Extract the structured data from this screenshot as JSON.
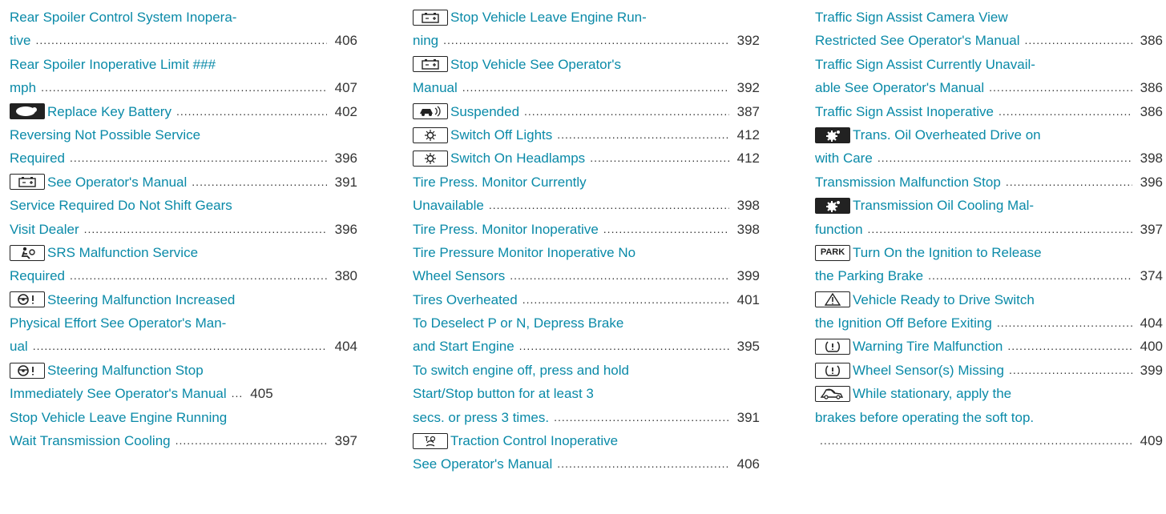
{
  "columns": [
    {
      "entries": [
        {
          "lines": [
            "Rear Spoiler Control System Inopera-",
            "tive"
          ],
          "page": "406"
        },
        {
          "lines": [
            "Rear Spoiler Inoperative Limit ###",
            "mph"
          ],
          "page": "407"
        },
        {
          "icon": "key-battery-icon",
          "lines": [
            "Replace Key Battery"
          ],
          "page": "402"
        },
        {
          "lines": [
            "Reversing Not Possible Service",
            "Required"
          ],
          "page": "396"
        },
        {
          "icon": "battery-icon",
          "lines": [
            "See Operator's Manual"
          ],
          "page": "391"
        },
        {
          "lines": [
            "Service Required Do Not Shift Gears",
            "Visit Dealer"
          ],
          "page": "396"
        },
        {
          "icon": "airbag-icon",
          "lines": [
            "SRS Malfunction Service",
            "Required"
          ],
          "page": "380"
        },
        {
          "icon": "steering-warning-icon",
          "lines": [
            "Steering Malfunction Increased",
            "Physical Effort See Operator's Man-",
            "ual"
          ],
          "page": "404"
        },
        {
          "icon": "steering-warning-icon",
          "lines": [
            "Steering Malfunction Stop",
            "Immediately See Operator's Manual"
          ],
          "page": "405",
          "short_leader": true
        },
        {
          "lines": [
            "Stop Vehicle Leave Engine Running",
            "Wait Transmission Cooling"
          ],
          "page": "397"
        }
      ]
    },
    {
      "entries": [
        {
          "icon": "battery-icon",
          "lines": [
            "Stop Vehicle Leave Engine Run-",
            "ning"
          ],
          "page": "392"
        },
        {
          "icon": "battery-icon",
          "lines": [
            "Stop Vehicle See Operator's",
            "Manual"
          ],
          "page": "392"
        },
        {
          "icon": "distance-assist-icon",
          "lines": [
            "Suspended"
          ],
          "page": "387"
        },
        {
          "icon": "light-icon",
          "lines": [
            "Switch Off Lights"
          ],
          "page": "412"
        },
        {
          "icon": "light-icon",
          "lines": [
            "Switch On Headlamps"
          ],
          "page": "412"
        },
        {
          "lines": [
            "Tire Press. Monitor Currently",
            "Unavailable"
          ],
          "page": "398"
        },
        {
          "lines": [
            "Tire Press. Monitor Inoperative"
          ],
          "page": "398"
        },
        {
          "lines": [
            "Tire Pressure Monitor Inoperative No",
            "Wheel Sensors"
          ],
          "page": "399"
        },
        {
          "lines": [
            "Tires Overheated"
          ],
          "page": "401"
        },
        {
          "lines": [
            "To Deselect P or N, Depress Brake",
            "and Start Engine"
          ],
          "page": "395"
        },
        {
          "lines": [
            "To switch engine off, press and hold",
            "Start/Stop button for at least 3",
            "secs. or press 3 times."
          ],
          "page": "391"
        },
        {
          "icon": "traction-control-icon",
          "lines": [
            "Traction Control Inoperative",
            "See Operator's Manual"
          ],
          "page": "406"
        }
      ]
    },
    {
      "entries": [
        {
          "lines": [
            "Traffic Sign Assist Camera View",
            "Restricted See Operator's Manual"
          ],
          "page": "386"
        },
        {
          "lines": [
            "Traffic Sign Assist Currently Unavail-",
            "able See Operator's Manual"
          ],
          "page": "386"
        },
        {
          "lines": [
            "Traffic Sign Assist Inoperative"
          ],
          "page": "386"
        },
        {
          "icon": "transmission-gear-icon",
          "lines": [
            "Trans. Oil Overheated Drive on",
            "with Care"
          ],
          "page": "398"
        },
        {
          "lines": [
            "Transmission Malfunction Stop"
          ],
          "page": "396"
        },
        {
          "icon": "transmission-gear-icon",
          "lines": [
            "Transmission Oil Cooling Mal-",
            "function"
          ],
          "page": "397"
        },
        {
          "icon": "park-brake-icon",
          "icon_text": "PARK",
          "lines": [
            "Turn On the Ignition to Release",
            "the Parking Brake"
          ],
          "page": "374"
        },
        {
          "icon": "warning-triangle-icon",
          "lines": [
            "Vehicle Ready to Drive Switch",
            "the Ignition Off Before Exiting"
          ],
          "page": "404"
        },
        {
          "icon": "tire-warning-icon",
          "lines": [
            "Warning Tire Malfunction"
          ],
          "page": "400"
        },
        {
          "icon": "tire-warning-icon",
          "lines": [
            "Wheel Sensor(s) Missing"
          ],
          "page": "399"
        },
        {
          "icon": "soft-top-icon",
          "lines": [
            "While stationary, apply the",
            "brakes before operating the soft top.",
            ""
          ],
          "page": "409"
        }
      ]
    }
  ]
}
